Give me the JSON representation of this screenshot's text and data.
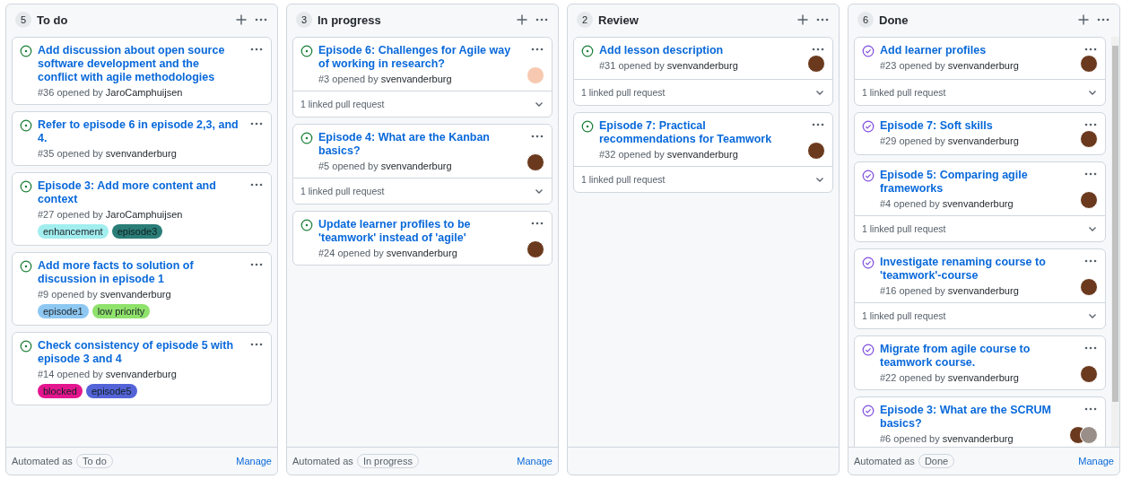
{
  "columns": [
    {
      "count": "5",
      "title": "To do",
      "automated_label": "Automated as",
      "automation": "To do",
      "manage": "Manage",
      "scrollable": false,
      "cards": [
        {
          "closed": false,
          "title": "Add discussion about open source software development and the conflict with agile methodologies",
          "meta": "#36 opened by",
          "author": "JaroCamphuijsen"
        },
        {
          "closed": false,
          "title": "Refer to episode 6 in episode 2,3, and 4.",
          "meta": "#35 opened by",
          "author": "svenvanderburg"
        },
        {
          "closed": false,
          "title": "Episode 3: Add more content and context",
          "meta": "#27 opened by",
          "author": "JaroCamphuijsen",
          "labels": [
            {
              "name": "enhancement",
              "color": "#a2eeef"
            },
            {
              "name": "episode3",
              "color": "#2b7d78"
            }
          ]
        },
        {
          "closed": false,
          "title": "Add more facts to solution of discussion in episode 1",
          "meta": "#9 opened by",
          "author": "svenvanderburg",
          "labels": [
            {
              "name": "episode1",
              "color": "#8ec8f2"
            },
            {
              "name": "low priority",
              "color": "#8fe26b"
            }
          ]
        },
        {
          "closed": false,
          "title": "Check consistency of episode 5 with episode 3 and 4",
          "meta": "#14 opened by",
          "author": "svenvanderburg",
          "labels": [
            {
              "name": "blocked",
              "color": "#e4168f"
            },
            {
              "name": "episode5",
              "color": "#5464d8"
            }
          ]
        }
      ]
    },
    {
      "count": "3",
      "title": "In progress",
      "automated_label": "Automated as",
      "automation": "In progress",
      "manage": "Manage",
      "scrollable": false,
      "cards": [
        {
          "closed": false,
          "title": "Episode 6: Challenges for Agile way of working in research?",
          "meta": "#3 opened by",
          "author": "svenvanderburg",
          "avatars": [
            {
              "kind": "drawing"
            }
          ],
          "linked": "1 linked pull request"
        },
        {
          "closed": false,
          "title": "Episode 4: What are the Kanban basics?",
          "meta": "#5 opened by",
          "author": "svenvanderburg",
          "avatars": [
            {
              "kind": "photo"
            }
          ],
          "linked": "1 linked pull request"
        },
        {
          "closed": false,
          "title": "Update learner profiles to be 'teamwork' instead of 'agile'",
          "meta": "#24 opened by",
          "author": "svenvanderburg",
          "avatars": [
            {
              "kind": "photo"
            }
          ]
        }
      ]
    },
    {
      "count": "2",
      "title": "Review",
      "scrollable": false,
      "cards": [
        {
          "closed": false,
          "title": "Add lesson description",
          "meta": "#31 opened by",
          "author": "svenvanderburg",
          "avatars": [
            {
              "kind": "photo"
            }
          ],
          "linked": "1 linked pull request"
        },
        {
          "closed": false,
          "title": "Episode 7: Practical recommendations for Teamwork",
          "meta": "#32 opened by",
          "author": "svenvanderburg",
          "avatars": [
            {
              "kind": "photo"
            }
          ],
          "linked": "1 linked pull request"
        }
      ]
    },
    {
      "count": "6",
      "title": "Done",
      "automated_label": "Automated as",
      "automation": "Done",
      "manage": "Manage",
      "scrollable": true,
      "cards": [
        {
          "closed": true,
          "title": "Add learner profiles",
          "meta": "#23 opened by",
          "author": "svenvanderburg",
          "avatars": [
            {
              "kind": "photo"
            }
          ],
          "linked": "1 linked pull request"
        },
        {
          "closed": true,
          "title": "Episode 7: Soft skills",
          "meta": "#29 opened by",
          "author": "svenvanderburg",
          "avatars": [
            {
              "kind": "photo"
            }
          ]
        },
        {
          "closed": true,
          "title": "Episode 5: Comparing agile frameworks",
          "meta": "#4 opened by",
          "author": "svenvanderburg",
          "avatars": [
            {
              "kind": "photo"
            }
          ],
          "linked": "1 linked pull request"
        },
        {
          "closed": true,
          "title": "Investigate renaming course to 'teamwork'-course",
          "meta": "#16 opened by",
          "author": "svenvanderburg",
          "avatars": [
            {
              "kind": "photo"
            }
          ],
          "linked": "1 linked pull request"
        },
        {
          "closed": true,
          "title": "Migrate from agile course to teamwork course.",
          "meta": "#22 opened by",
          "author": "svenvanderburg",
          "avatars": [
            {
              "kind": "photo"
            }
          ]
        },
        {
          "closed": true,
          "title": "Episode 3: What are the SCRUM basics?",
          "meta": "#6 opened by",
          "author": "svenvanderburg",
          "avatars": [
            {
              "kind": "photo"
            },
            {
              "kind": "photo"
            }
          ]
        }
      ]
    }
  ]
}
